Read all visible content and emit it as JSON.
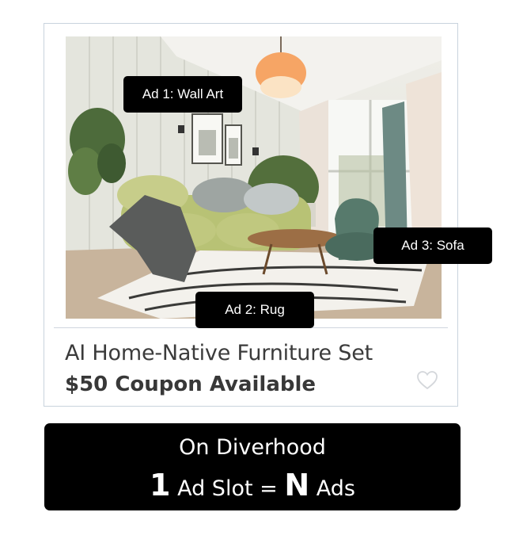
{
  "ad_tags": {
    "wall_art": "Ad 1: Wall Art",
    "rug": "Ad 2: Rug",
    "sofa": "Ad 3: Sofa"
  },
  "product": {
    "title": "AI Home-Native Furniture Set",
    "coupon": "$50 Coupon Available",
    "favorite_icon": "heart-outline-icon"
  },
  "banner": {
    "line1": "On Diverhood",
    "count_one": "1",
    "ad_slot_text": " Ad Slot = ",
    "count_n": "N",
    "ads_text": " Ads"
  },
  "colors": {
    "tag_background": "#000000",
    "banner_background": "#000000",
    "card_border": "#c9d3dd"
  }
}
